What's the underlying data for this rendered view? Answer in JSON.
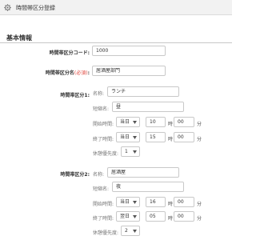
{
  "header": {
    "title": "時間帯区分登録",
    "icon": "gear-icon"
  },
  "section": {
    "title": "基本情報"
  },
  "fields": {
    "code": {
      "label": "時間帯区分コード:",
      "value": "1000"
    },
    "name": {
      "label": "時間帯区分名",
      "required": "(必須)",
      "colon": ":",
      "value": "居酒屋部門"
    }
  },
  "labels": {
    "name": "名称:",
    "short_name": "短縮名:",
    "start": "開始時間:",
    "end": "終了時間:",
    "priority": "休憩優先度:",
    "hour": "時",
    "minute": "分"
  },
  "divisions": [
    {
      "label": "時間帯区分1:",
      "name": "ランチ",
      "short_name": "昼",
      "start": {
        "day": "当日",
        "hour": "10",
        "minute": "00"
      },
      "end": {
        "day": "当日",
        "hour": "15",
        "minute": "00"
      },
      "priority": "1"
    },
    {
      "label": "時間帯区分2:",
      "name": "居酒屋",
      "short_name": "夜",
      "start": {
        "day": "当日",
        "hour": "16",
        "minute": "00"
      },
      "end": {
        "day": "翌日",
        "hour": "05",
        "minute": "00"
      },
      "priority": "2"
    }
  ],
  "colors": {
    "required": "#e0463c",
    "header_bg": "#f2f2f2",
    "border": "#c9c9c9"
  }
}
